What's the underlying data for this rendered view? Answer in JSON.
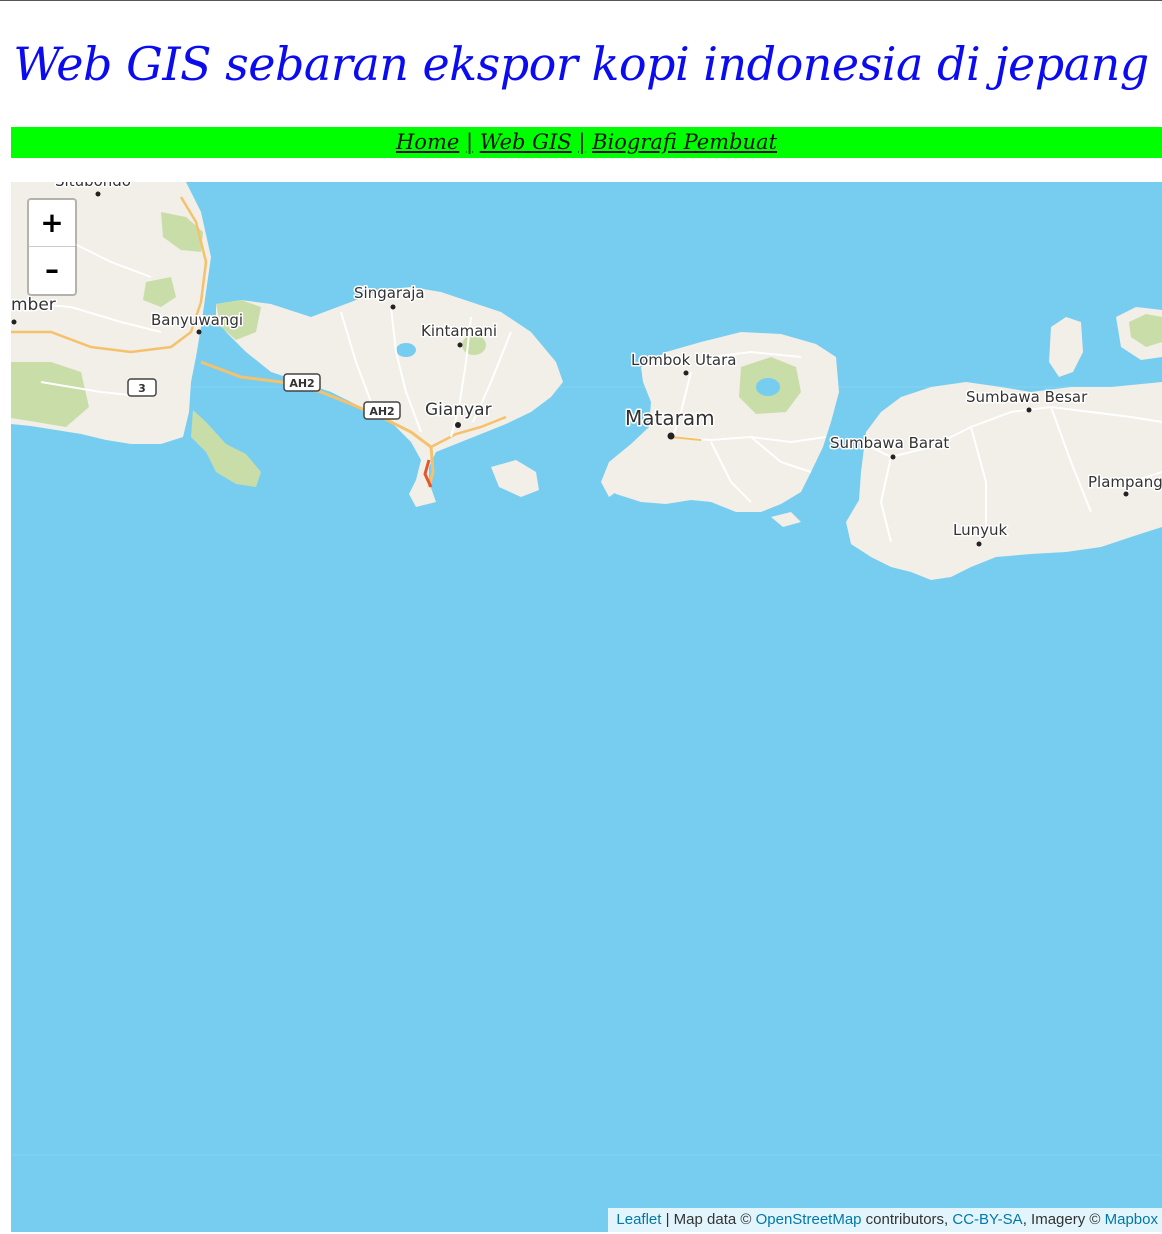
{
  "header": {
    "title": "Web GIS sebaran ekspor kopi indonesia di jepang"
  },
  "nav": {
    "home": "Home",
    "webgis": "Web GIS",
    "bio": "Biografi Pembuat",
    "separator": "|"
  },
  "map": {
    "zoom_in": "+",
    "zoom_out": "–",
    "places": {
      "situbondo": "Situbondo",
      "jember": "mber",
      "banyuwangi": "Banyuwangi",
      "singaraja": "Singaraja",
      "kintamani": "Kintamani",
      "gianyar": "Gianyar",
      "lombok_utara": "Lombok Utara",
      "mataram": "Mataram",
      "sumbawa_besar": "Sumbawa Besar",
      "sumbawa_barat": "Sumbawa Barat",
      "plampang": "Plampang",
      "lunyuk": "Lunyuk"
    },
    "shields": {
      "route3": "3",
      "ah2_a": "AH2",
      "ah2_b": "AH2"
    },
    "colors": {
      "water": "#76cdf0",
      "land": "#f2eee8",
      "park": "#c9dda8"
    }
  },
  "attribution": {
    "leaflet": "Leaflet",
    "sep1": " | Map data © ",
    "osm": "OpenStreetMap",
    "contributors": " contributors, ",
    "license": "CC-BY-SA",
    "imagery": ", Imagery © ",
    "mapbox": "Mapbox"
  }
}
